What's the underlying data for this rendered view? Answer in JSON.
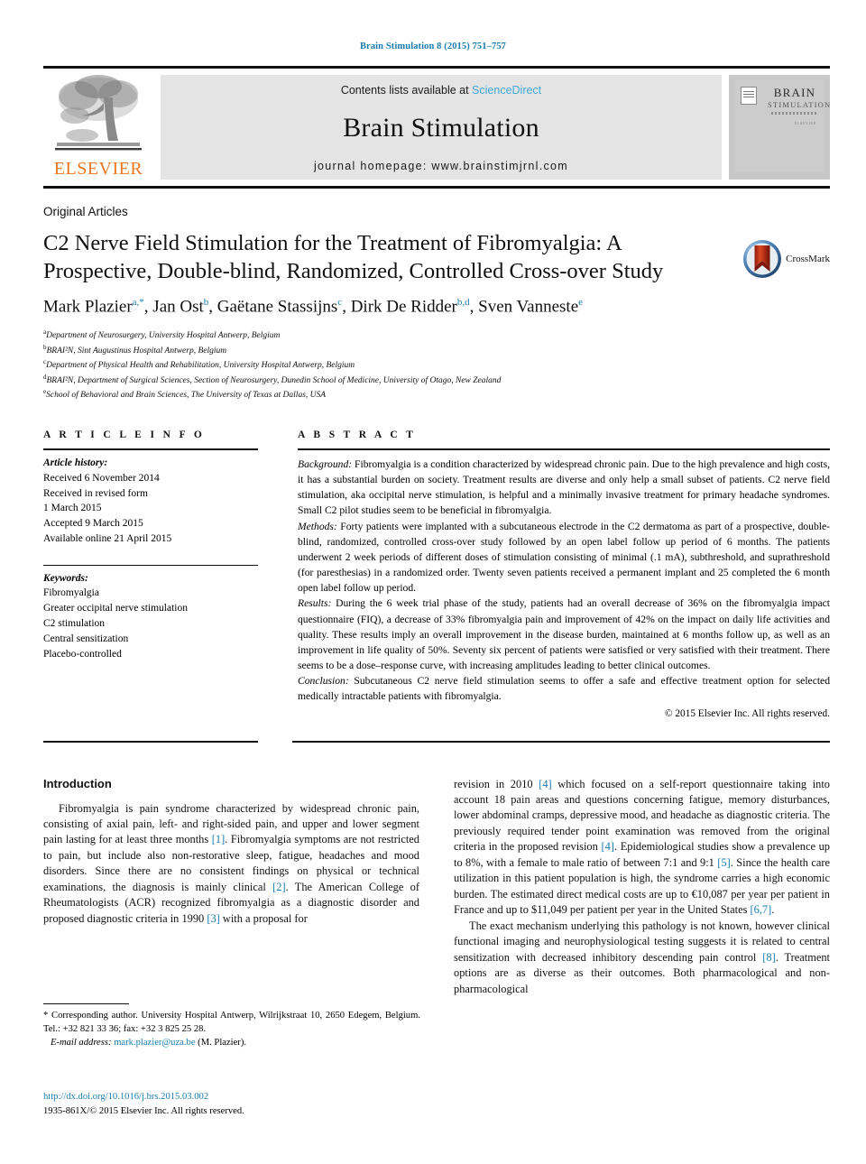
{
  "running_head": "Brain Stimulation 8 (2015) 751–757",
  "masthead": {
    "publisher_logo_text": "ELSEVIER",
    "contents_prefix": "Contents lists available at ",
    "contents_link": "ScienceDirect",
    "journal_title": "Brain Stimulation",
    "homepage": "journal homepage: www.brainstimjrnl.com",
    "cover": {
      "line1": "BRAIN",
      "line2": "STIMULATION",
      "small_note": "ELSEVIER"
    }
  },
  "article": {
    "section_kind": "Original Articles",
    "title": "C2 Nerve Field Stimulation for the Treatment of Fibromyalgia: A Prospective, Double-blind, Randomized, Controlled Cross-over Study",
    "crossmark_label": "CrossMark",
    "authors_html": "Mark Plazier<sup>a,*</sup>, Jan Ost<sup>b</sup>, Gaëtane Stassijns<sup>c</sup>, Dirk De Ridder<sup>b,d</sup>, Sven Vanneste<sup>e</sup>",
    "affiliations": [
      {
        "mark": "a",
        "text": "Department of Neurosurgery, University Hospital Antwerp, Belgium"
      },
      {
        "mark": "b",
        "text": "BRAI²N, Sint Augustinus Hospital Antwerp, Belgium"
      },
      {
        "mark": "c",
        "text": "Department of Physical Health and Rehabilitation, University Hospital Antwerp, Belgium"
      },
      {
        "mark": "d",
        "text": "BRAI²N, Department of Surgical Sciences, Section of Neurosurgery, Dunedin School of Medicine, University of Otago, New Zealand"
      },
      {
        "mark": "e",
        "text": "School of Behavioral and Brain Sciences, The University of Texas at Dallas, USA"
      }
    ]
  },
  "article_info": {
    "label": "A R T I C L E   I N F O",
    "history_label": "Article history:",
    "history": [
      "Received 6 November 2014",
      "Received in revised form",
      "1 March 2015",
      "Accepted 9 March 2015",
      "Available online 21 April 2015"
    ],
    "keywords_label": "Keywords:",
    "keywords": [
      "Fibromyalgia",
      "Greater occipital nerve stimulation",
      "C2 stimulation",
      "Central sensitization",
      "Placebo-controlled"
    ]
  },
  "abstract": {
    "label": "A B S T R A C T",
    "background_label": "Background:",
    "background": " Fibromyalgia is a condition characterized by widespread chronic pain. Due to the high prevalence and high costs, it has a substantial burden on society. Treatment results are diverse and only help a small subset of patients. C2 nerve field stimulation, aka occipital nerve stimulation, is helpful and a minimally invasive treatment for primary headache syndromes. Small C2 pilot studies seem to be beneficial in fibromyalgia.",
    "methods_label": "Methods:",
    "methods": " Forty patients were implanted with a subcutaneous electrode in the C2 dermatoma as part of a prospective, double-blind, randomized, controlled cross-over study followed by an open label follow up period of 6 months. The patients underwent 2 week periods of different doses of stimulation consisting of minimal (.1 mA), subthreshold, and suprathreshold (for paresthesias) in a randomized order. Twenty seven patients received a permanent implant and 25 completed the 6 month open label follow up period.",
    "results_label": "Results:",
    "results": " During the 6 week trial phase of the study, patients had an overall decrease of 36% on the fibromyalgia impact questionnaire (FIQ), a decrease of 33% fibromyalgia pain and improvement of 42% on the impact on daily life activities and quality. These results imply an overall improvement in the disease burden, maintained at 6 months follow up, as well as an improvement in life quality of 50%. Seventy six percent of patients were satisfied or very satisfied with their treatment. There seems to be a dose–response curve, with increasing amplitudes leading to better clinical outcomes.",
    "conclusion_label": "Conclusion:",
    "conclusion": " Subcutaneous C2 nerve field stimulation seems to offer a safe and effective treatment option for selected medically intractable patients with fibromyalgia.",
    "copyright": "© 2015 Elsevier Inc. All rights reserved."
  },
  "body": {
    "intro_heading": "Introduction",
    "left_paragraph_1": "Fibromyalgia is pain syndrome characterized by widespread chronic pain, consisting of axial pain, left- and right-sided pain, and upper and lower segment pain lasting for at least three months [1]. Fibromyalgia symptoms are not restricted to pain, but include also non-restorative sleep, fatigue, headaches and mood disorders. Since there are no consistent findings on physical or technical examinations, the diagnosis is mainly clinical [2]. The American College of Rheumatologists (ACR) recognized fibromyalgia as a diagnostic disorder and proposed diagnostic criteria in 1990 [3] with a proposal for",
    "right_paragraph_1": "revision in 2010 [4] which focused on a self-report questionnaire taking into account 18 pain areas and questions concerning fatigue, memory disturbances, lower abdominal cramps, depressive mood, and headache as diagnostic criteria. The previously required tender point examination was removed from the original criteria in the proposed revision [4]. Epidemiological studies show a prevalence up to 8%, with a female to male ratio of between 7:1 and 9:1 [5]. Since the health care utilization in this patient population is high, the syndrome carries a high economic burden. The estimated direct medical costs are up to €10,087 per year per patient in France and up to $11,049 per patient per year in the United States [6,7].",
    "right_paragraph_2": "The exact mechanism underlying this pathology is not known, however clinical functional imaging and neurophysiological testing suggests it is related to central sensitization with decreased inhibitory descending pain control [8]. Treatment options are as diverse as their outcomes. Both pharmacological and non-pharmacological"
  },
  "footnote": {
    "corresponding": "* Corresponding author. University Hospital Antwerp, Wilrijkstraat 10, 2650 Edegem, Belgium. Tel.: +32 821 33 36; fax: +32 3 825 25 28.",
    "email_label": "E-mail address:",
    "email": "mark.plazier@uza.be",
    "email_suffix": " (M. Plazier)."
  },
  "doi_block": {
    "doi": "http://dx.doi.org/10.1016/j.brs.2015.03.002",
    "issn_line": "1935-861X/© 2015 Elsevier Inc. All rights reserved."
  },
  "colors": {
    "link": "#1a7cad",
    "sciencedirect": "#3fa9d8",
    "elsevier_orange": "#E87722",
    "masthead_bg": "#e4e4e4"
  }
}
